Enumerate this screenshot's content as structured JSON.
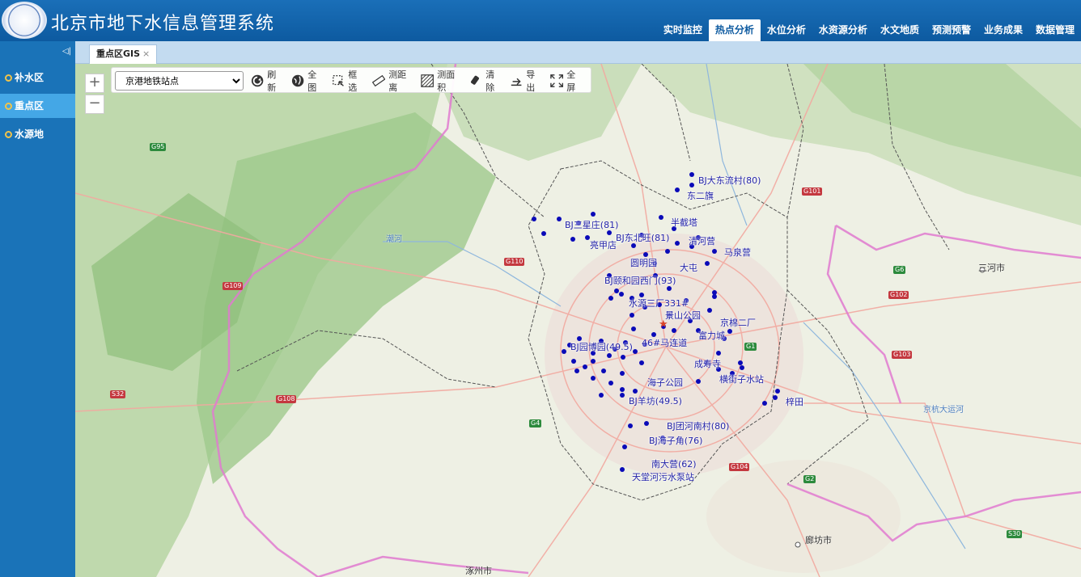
{
  "header": {
    "title": "北京市地下水信息管理系统",
    "nav": [
      "实时监控",
      "热点分析",
      "水位分析",
      "水资源分析",
      "水文地质",
      "预测预警",
      "业务成果",
      "数据管理"
    ],
    "active_nav": "热点分析"
  },
  "sidebar": {
    "items": [
      {
        "label": "补水区",
        "active": false
      },
      {
        "label": "重点区",
        "active": true
      },
      {
        "label": "水源地",
        "active": false
      }
    ]
  },
  "tab": {
    "label": "重点区GIS",
    "close": "×"
  },
  "toolbar": {
    "layer_select": "京港地铁站点",
    "tools": [
      {
        "label": "刷新",
        "icon": "refresh-icon"
      },
      {
        "label": "全图",
        "icon": "globe-icon"
      },
      {
        "label": "框选",
        "icon": "box-select-icon"
      },
      {
        "label": "测距离",
        "icon": "ruler-icon"
      },
      {
        "label": "测面积",
        "icon": "area-icon"
      },
      {
        "label": "清除",
        "icon": "eraser-icon"
      },
      {
        "label": "导出",
        "icon": "export-icon"
      },
      {
        "label": "全屏",
        "icon": "fullscreen-icon"
      }
    ],
    "zoom_in": "+",
    "zoom_out": "−"
  },
  "map": {
    "station_labels": [
      "BJ大东流村(80)",
      "东二旗",
      "BJ三星庄(81)",
      "半截塔",
      "BJ东北旺(81)",
      "清河营",
      "亮甲店",
      "马泉营",
      "圆明园",
      "大屯",
      "BJ颐和园西门(93)",
      "水源三厂331#",
      "景山公园",
      "京棉二厂",
      "BJ园博园(49.5)",
      "46#马连道",
      "富力城",
      "成寿寺",
      "横街子水站",
      "海子公园",
      "BJ羊坊(49.5)",
      "BJ团河南村(80)",
      "BJ海子角(76)",
      "南大营(62)",
      "天堂河污水泵站",
      "梓田"
    ],
    "place_labels": [
      "三河市",
      "廊坊市",
      "涿州市",
      "京杭大运河",
      "潮河"
    ],
    "road_labels": [
      "G95",
      "G110",
      "G109",
      "G6",
      "G108",
      "G4",
      "G101",
      "G1",
      "G102",
      "G2",
      "G104",
      "S32",
      "G103",
      "S30"
    ],
    "marker_color": "#0a0ab8",
    "boundary_color": "#e07ad0"
  }
}
